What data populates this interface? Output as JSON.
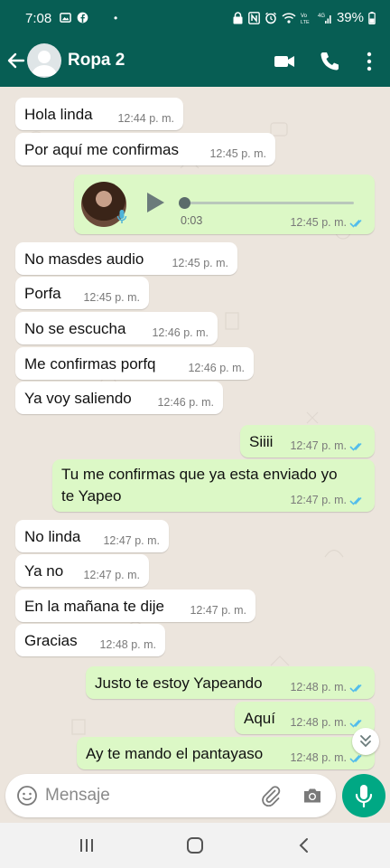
{
  "status_bar": {
    "time": "7:08",
    "dot": "•",
    "battery": "39%"
  },
  "header": {
    "title": "Ropa 2"
  },
  "messages": [
    {
      "dir": "in",
      "text": "Hola linda",
      "time": "12:44 p. m."
    },
    {
      "dir": "in",
      "text": "Por aquí me confirmas",
      "time": "12:45 p. m."
    },
    {
      "dir": "out",
      "type": "audio",
      "duration": "0:03",
      "time": "12:45 p. m.",
      "read": true
    },
    {
      "dir": "in",
      "text": "No masdes audio",
      "time": "12:45 p. m."
    },
    {
      "dir": "in",
      "text": "Porfa",
      "time": "12:45 p. m."
    },
    {
      "dir": "in",
      "text": "No se escucha",
      "time": "12:46 p. m."
    },
    {
      "dir": "in",
      "text": "Me confirmas porfq",
      "time": "12:46 p. m."
    },
    {
      "dir": "in",
      "text": "Ya voy saliendo",
      "time": "12:46 p. m."
    },
    {
      "dir": "out",
      "text": "Siiii",
      "time": "12:47 p. m.",
      "read": true
    },
    {
      "dir": "out",
      "text_line1": "Tu me confirmas que ya esta enviado yo",
      "text_line2": "te Yapeo",
      "time": "12:47 p. m.",
      "read": true
    },
    {
      "dir": "in",
      "text": "No linda",
      "time": "12:47 p. m."
    },
    {
      "dir": "in",
      "text": "Ya no",
      "time": "12:47 p. m."
    },
    {
      "dir": "in",
      "text": "En la mañana te dije",
      "time": "12:47 p. m."
    },
    {
      "dir": "in",
      "text": "Gracias",
      "time": "12:48 p. m."
    },
    {
      "dir": "out",
      "text": "Justo te estoy Yapeando",
      "time": "12:48 p. m.",
      "read": true
    },
    {
      "dir": "out",
      "text": "Aquí",
      "time": "12:48 p. m.",
      "read": true
    },
    {
      "dir": "out",
      "text": "Ay te mando el pantayaso",
      "time": "12:48 p. m.",
      "read": true
    }
  ],
  "input": {
    "placeholder": "Mensaje"
  },
  "colors": {
    "header": "#075e54",
    "chat_bg": "#ece5dd",
    "outgoing": "#dcf8c6",
    "incoming": "#ffffff",
    "read_tick": "#53bdeb",
    "mic_button": "#00a884"
  },
  "icons": {
    "back": "arrow-left-icon",
    "video": "video-camera-icon",
    "call": "phone-icon",
    "menu": "more-vertical-icon",
    "emoji": "emoji-icon",
    "attach": "paperclip-icon",
    "camera": "camera-icon",
    "mic": "microphone-icon"
  }
}
